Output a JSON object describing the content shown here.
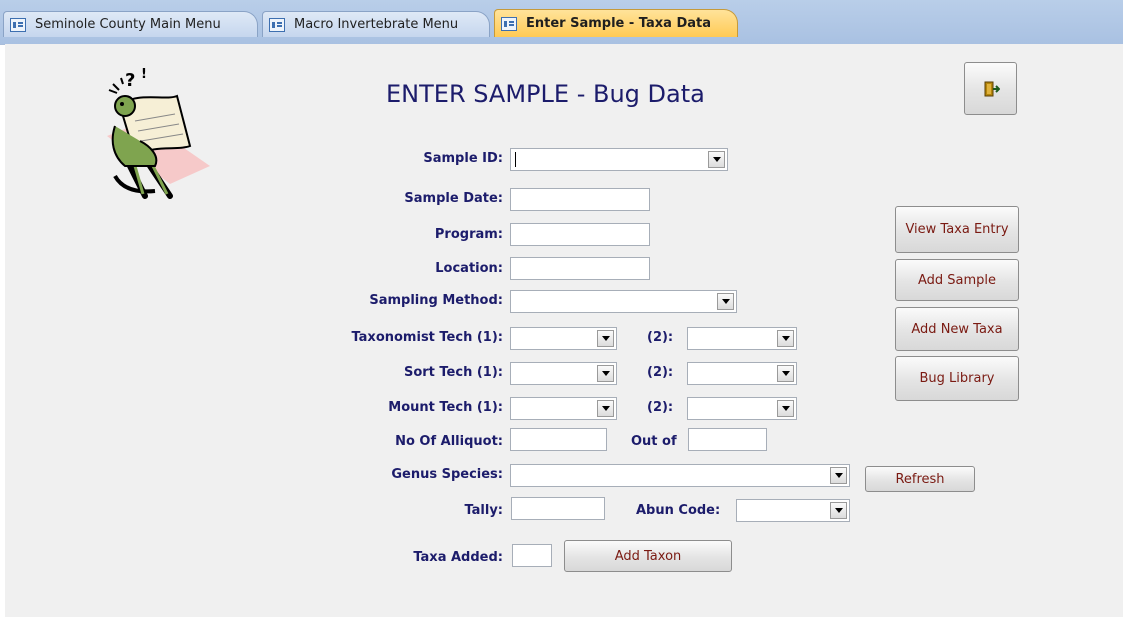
{
  "tabs": [
    {
      "label": "Seminole County Main Menu",
      "active": false
    },
    {
      "label": "Macro Invertebrate Menu",
      "active": false
    },
    {
      "label": "Enter Sample - Taxa Data",
      "active": true
    }
  ],
  "form": {
    "title": "ENTER SAMPLE - Bug Data",
    "labels": {
      "sample_id": "Sample ID:",
      "sample_date": "Sample Date:",
      "program": "Program:",
      "location": "Location:",
      "sampling_method": "Sampling Method:",
      "taxonomist_tech_1": "Taxonomist Tech (1):",
      "tech_2": "(2):",
      "sort_tech_1": "Sort Tech (1):",
      "mount_tech_1": "Mount Tech (1):",
      "no_of_alliquot": "No Of Alliquot:",
      "out_of": "Out of",
      "genus_species": "Genus Species:",
      "tally": "Tally:",
      "abun_code": "Abun Code:",
      "taxa_added": "Taxa Added:"
    },
    "values": {
      "sample_id": "",
      "sample_date": "",
      "program": "",
      "location": "",
      "sampling_method": "",
      "taxonomist_tech_1": "",
      "taxonomist_tech_2": "",
      "sort_tech_1": "",
      "sort_tech_2": "",
      "mount_tech_1": "",
      "mount_tech_2": "",
      "no_of_alliquot": "",
      "out_of": "",
      "genus_species": "",
      "tally": "",
      "abun_code": "",
      "taxa_added": ""
    },
    "buttons": {
      "view_taxa_entry": "View Taxa Entry",
      "add_sample": "Add Sample",
      "add_new_taxa": "Add New Taxa",
      "bug_library": "Bug Library",
      "refresh": "Refresh",
      "add_taxon": "Add Taxon"
    },
    "icons": {
      "close_form": "exit-door-icon",
      "tab": "form-icon",
      "clipart": "confused-reader-clipart"
    },
    "colors": {
      "label": "#1c1c6b",
      "button_text": "#7a1a12",
      "active_tab": "#ffca55",
      "form_bg": "#f0f0f0"
    }
  }
}
